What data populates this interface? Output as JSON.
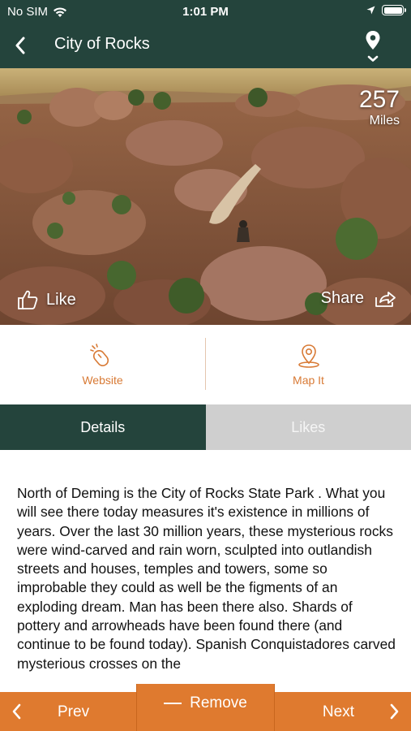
{
  "status_bar": {
    "carrier": "No SIM",
    "time": "1:01 PM"
  },
  "navbar": {
    "title": "City of Rocks",
    "back_icon": "chevron-left-icon",
    "pin_icon": "map-pin-icon"
  },
  "hero": {
    "distance_value": "257",
    "distance_unit": "Miles",
    "like_label": "Like",
    "share_label": "Share"
  },
  "actions": {
    "website_label": "Website",
    "mapit_label": "Map It"
  },
  "tabs": [
    {
      "label": "Details",
      "active": true
    },
    {
      "label": "Likes",
      "active": false
    }
  ],
  "description": "North of Deming is the City of Rocks State Park . What you will see there today measures it's existence in millions of years. Over the last 30 million years, these mysterious rocks were wind-carved and rain worn, sculpted into outlandish streets and houses, temples and towers, some so improbable they could as well be the figments of an exploding dream. Man has been there also. Shards of pottery and arrowheads have been found there (and continue to be found today). Spanish Conquistadores carved mysterious crosses on the",
  "bottom_bar": {
    "prev_label": "Prev",
    "remove_label": "Remove",
    "next_label": "Next"
  },
  "colors": {
    "header": "#24443c",
    "accent": "#df7a2f",
    "inactive_tab": "#cfcfcf"
  }
}
